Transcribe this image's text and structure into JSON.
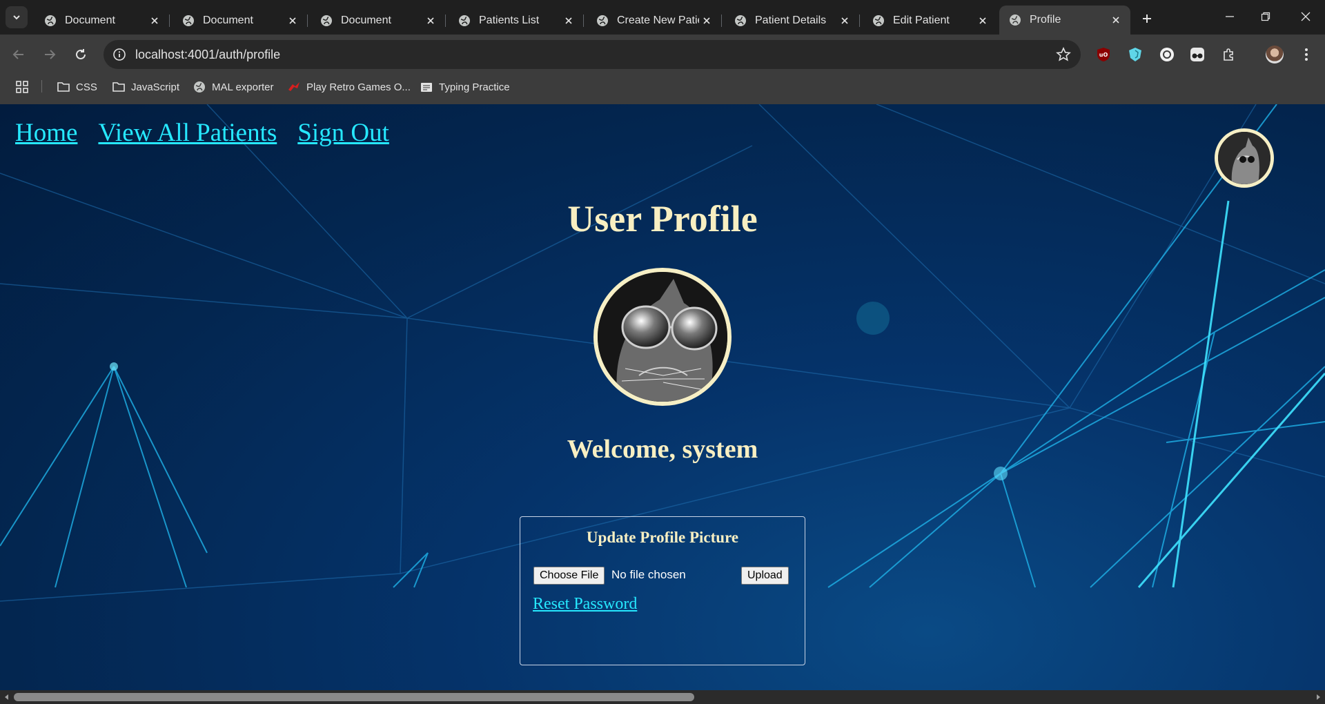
{
  "browser": {
    "tabs": [
      {
        "title": "Document"
      },
      {
        "title": "Document"
      },
      {
        "title": "Document"
      },
      {
        "title": "Patients List"
      },
      {
        "title": "Create New Patie"
      },
      {
        "title": "Patient Details"
      },
      {
        "title": "Edit Patient"
      },
      {
        "title": "Profile"
      }
    ],
    "active_tab_index": 7,
    "url": "localhost:4001/auth/profile",
    "bookmarks": [
      {
        "label": "CSS",
        "icon": "folder-icon"
      },
      {
        "label": "JavaScript",
        "icon": "folder-icon"
      },
      {
        "label": "MAL exporter",
        "icon": "globe-icon"
      },
      {
        "label": "Play Retro Games O...",
        "icon": "retro-games-icon"
      },
      {
        "label": "Typing Practice",
        "icon": "typing-icon"
      }
    ]
  },
  "page": {
    "nav": {
      "home": "Home",
      "view_all": "View All Patients",
      "sign_out": "Sign Out"
    },
    "title": "User Profile",
    "welcome": "Welcome, system",
    "upload_card": {
      "title": "Update Profile Picture",
      "choose_file": "Choose File",
      "file_status": "No file chosen",
      "upload": "Upload",
      "reset_password": "Reset Password"
    }
  },
  "colors": {
    "link": "#26e8ff",
    "heading": "#f8efc2",
    "background": "#032650"
  }
}
